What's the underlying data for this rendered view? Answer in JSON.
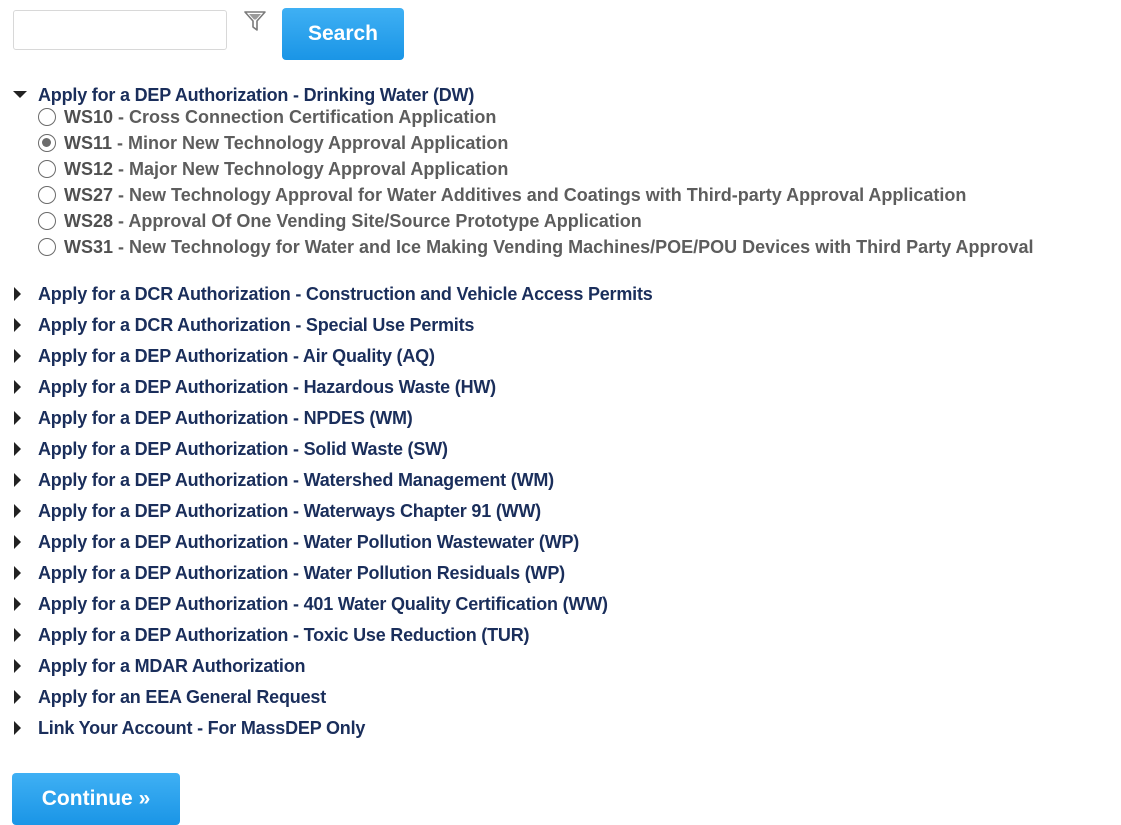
{
  "search": {
    "placeholder": "",
    "value": "",
    "button_label": "Search",
    "filter_icon": "filter-icon"
  },
  "expanded_group": {
    "label": "Apply for a DEP Authorization - Drinking Water (DW)",
    "options": [
      {
        "code": "WS10",
        "text": " - Cross Connection Certification Application",
        "checked": false
      },
      {
        "code": "WS11",
        "text": " - Minor New Technology Approval Application",
        "checked": true
      },
      {
        "code": "WS12",
        "text": " - Major New Technology Approval Application",
        "checked": false
      },
      {
        "code": "WS27",
        "text": " - New Technology Approval for Water Additives and Coatings with Third-party Approval Application",
        "checked": false
      },
      {
        "code": "WS28",
        "text": " - Approval Of One Vending Site/Source Prototype Application",
        "checked": false
      },
      {
        "code": "WS31",
        "text": " - New Technology for Water and Ice Making Vending Machines/POE/POU Devices with Third Party Approval",
        "checked": false
      }
    ]
  },
  "collapsed_groups": [
    "Apply for a DCR Authorization - Construction and Vehicle Access Permits",
    "Apply for a DCR Authorization - Special Use Permits",
    "Apply for a DEP Authorization - Air Quality (AQ)",
    "Apply for a DEP Authorization - Hazardous Waste (HW)",
    "Apply for a DEP Authorization - NPDES (WM)",
    "Apply for a DEP Authorization - Solid Waste (SW)",
    "Apply for a DEP Authorization - Watershed Management (WM)",
    "Apply for a DEP Authorization - Waterways Chapter 91 (WW)",
    "Apply for a DEP Authorization - Water Pollution Wastewater (WP)",
    "Apply for a DEP Authorization - Water Pollution Residuals (WP)",
    "Apply for a DEP Authorization - 401 Water Quality Certification (WW)",
    "Apply for a DEP Authorization - Toxic Use Reduction (TUR)",
    "Apply for a MDAR Authorization",
    "Apply for an EEA General Request",
    "Link Your Account - For MassDEP Only"
  ],
  "continue_label": "Continue »",
  "colors": {
    "accent": "#1a95e6",
    "heading": "#1a2e5b",
    "option_text": "#5d5d5d"
  }
}
